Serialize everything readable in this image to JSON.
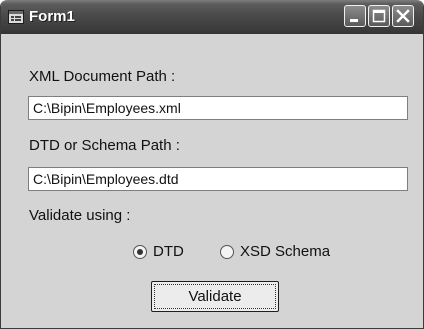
{
  "window": {
    "title": "Form1",
    "icon": "form-window-icon",
    "controls": [
      "minimize-icon",
      "maximize-icon",
      "close-icon"
    ]
  },
  "form": {
    "xml_path_label": "XML Document Path :",
    "xml_path_value": "C:\\Bipin\\Employees.xml",
    "schema_path_label": "DTD or Schema Path :",
    "schema_path_value": "C:\\Bipin\\Employees.dtd",
    "validate_using_label": "Validate using :",
    "options": [
      {
        "label": "DTD",
        "selected": true
      },
      {
        "label": "XSD Schema",
        "selected": false
      }
    ],
    "validate_button": "Validate"
  },
  "colors": {
    "titlebar": "#3c3c3c",
    "form_background": "#d4d4d4",
    "text": "#111111"
  }
}
